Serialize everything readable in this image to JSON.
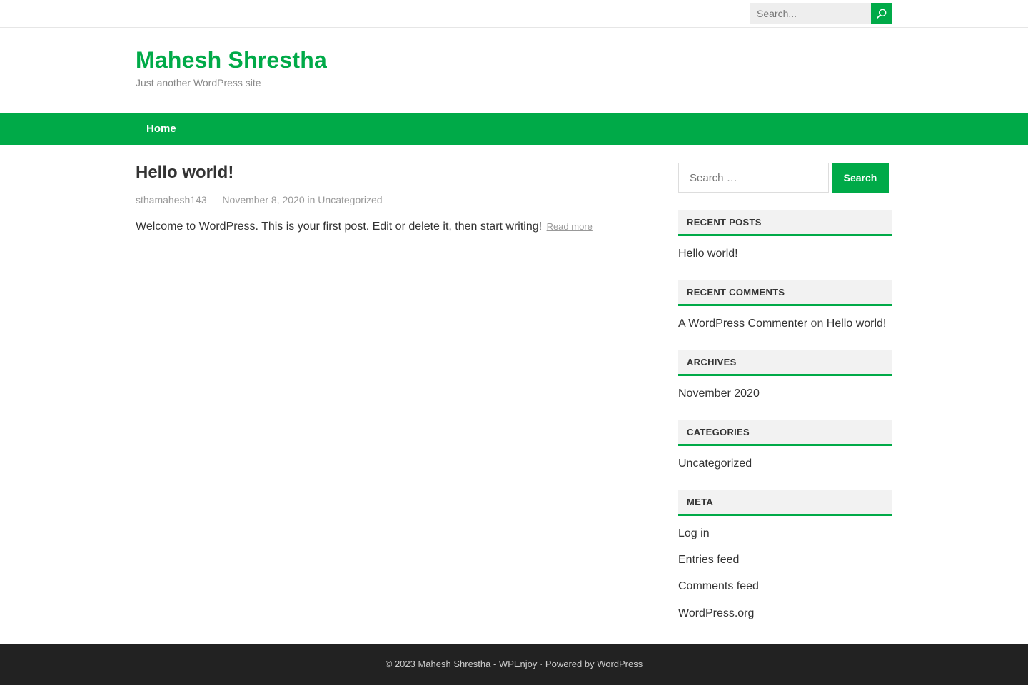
{
  "topbar": {
    "search_placeholder": "Search..."
  },
  "site": {
    "title": "Mahesh Shrestha",
    "description": "Just another WordPress site"
  },
  "nav": {
    "home": "Home"
  },
  "post": {
    "title": "Hello world!",
    "author": "sthamahesh143",
    "separator": " — ",
    "date": "November 8, 2020",
    "in": " in ",
    "category": "Uncategorized",
    "excerpt": "Welcome to WordPress. This is your first post. Edit or delete it, then start writing!",
    "read_more": "Read more"
  },
  "sidebar": {
    "search_placeholder": "Search …",
    "search_button": "Search",
    "recent_posts": {
      "heading": "RECENT POSTS",
      "items": [
        "Hello world!"
      ]
    },
    "recent_comments": {
      "heading": "RECENT COMMENTS",
      "author": "A WordPress Commenter",
      "on": " on ",
      "post": "Hello world!"
    },
    "archives": {
      "heading": "ARCHIVES",
      "items": [
        "November 2020"
      ]
    },
    "categories": {
      "heading": "CATEGORIES",
      "items": [
        "Uncategorized"
      ]
    },
    "meta": {
      "heading": "META",
      "items": [
        "Log in",
        "Entries feed",
        "Comments feed",
        "WordPress.org"
      ]
    }
  },
  "footer": {
    "copyright": "© 2023 Mahesh Shrestha - WPEnjoy · Powered by WordPress"
  },
  "colors": {
    "accent": "#00aa48",
    "footer_bg": "#222222"
  }
}
